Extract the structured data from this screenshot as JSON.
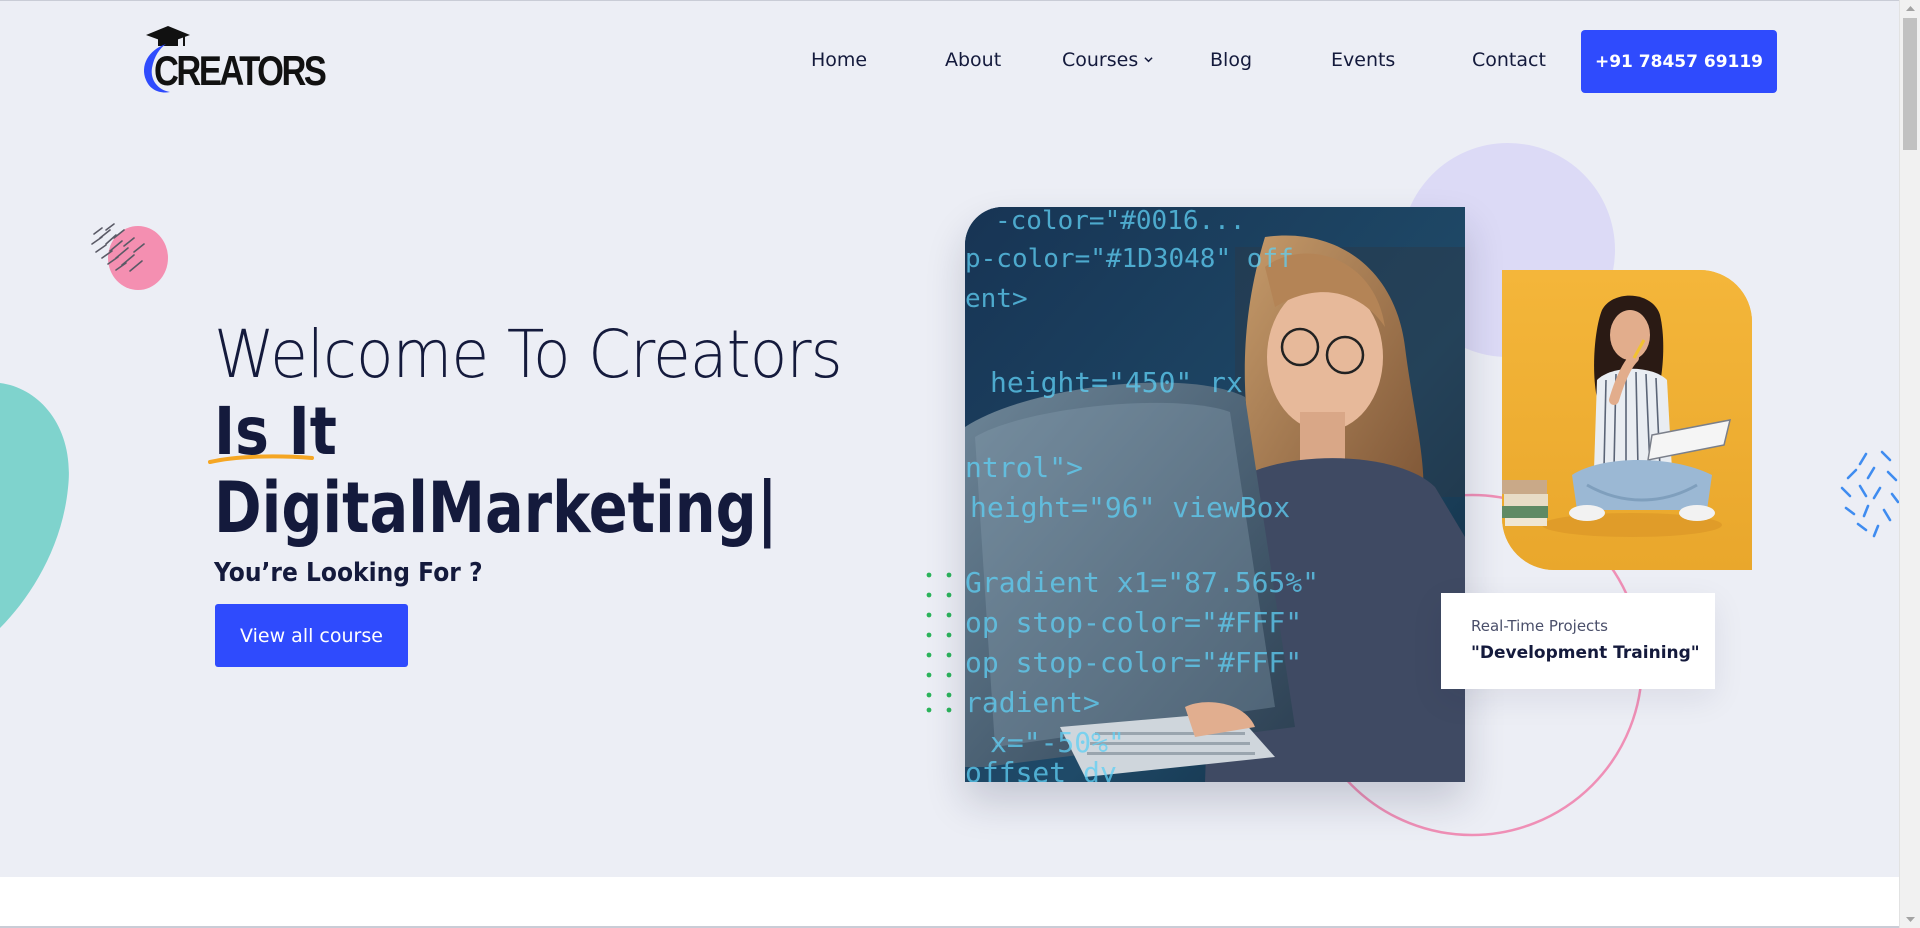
{
  "header": {
    "logo_text": "CREATORS",
    "nav": {
      "home": "Home",
      "about": "About",
      "courses": "Courses",
      "blog": "Blog",
      "events": "Events",
      "contact": "Contact"
    },
    "phone_button": "+91 78457 69119"
  },
  "hero": {
    "line1": "Welcome To Creators",
    "line2": "Is It",
    "line3": "DigitalMarketing|",
    "subtitle": "You’re Looking For ?",
    "cta": "View all course"
  },
  "feature_card": {
    "label": "Real-Time Projects",
    "title": "\"Development Training\""
  },
  "colors": {
    "primary": "#2f4bfd",
    "heading": "#141a3c",
    "background": "#eceef5",
    "teal_blob": "#7fd3cd",
    "pink_blob": "#f48fb1",
    "lavender_circle": "#dcdaf6",
    "pink_ring": "#ef8fb6",
    "green_dots": "#2bb45b",
    "blue_confetti": "#3f8cf0",
    "underline_mark": "#f5a623"
  },
  "icons": {
    "courses_dropdown": "chevron-down-icon",
    "logo_cap": "graduation-cap-icon"
  }
}
